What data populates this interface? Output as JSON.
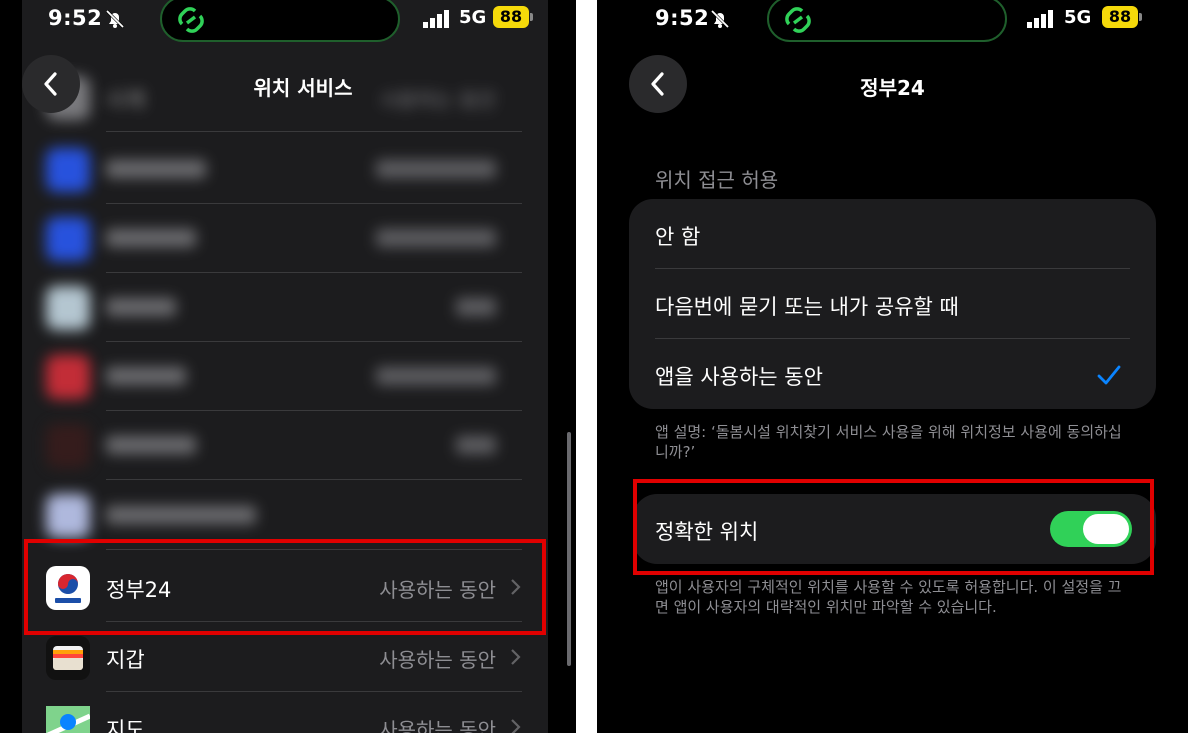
{
  "status_bar": {
    "time": "9:52",
    "network": "5G",
    "battery": "88"
  },
  "left": {
    "nav_title": "위치 서비스",
    "top_row": {
      "name": "시계",
      "value": "사용하는 동안"
    },
    "rows": [
      {
        "name": "정부24",
        "value": "사용하는 동안"
      },
      {
        "name": "지갑",
        "value": "사용하는 동안"
      },
      {
        "name": "지도",
        "value": "사용하는 동안"
      }
    ],
    "colors": {
      "highlight": "#e00000"
    }
  },
  "right": {
    "nav_title": "정부24",
    "section_header": "위치 접근 허용",
    "options": [
      {
        "label": "안 함"
      },
      {
        "label": "다음번에 묻기 또는 내가 공유할 때"
      },
      {
        "label": "앱을 사용하는 동안",
        "selected": true
      }
    ],
    "app_description": "앱 설명: ‘돌봄시설 위치찾기 서비스 사용을 위해 위치정보 사용에 동의하십니까?’",
    "precise_location": {
      "label": "정확한 위치",
      "enabled": true
    },
    "precise_note": "앱이 사용자의 구체적인 위치를 사용할 수 있도록 허용합니다. 이 설정을 끄면 앱이 사용자의 대략적인 위치만 파악할 수 있습니다.",
    "colors": {
      "accent": "#0a84ff",
      "toggle_on": "#30d158"
    }
  }
}
